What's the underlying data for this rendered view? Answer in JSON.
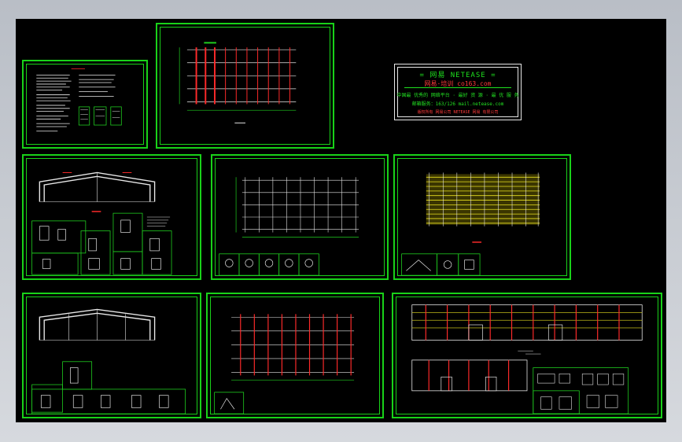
{
  "viewport": {
    "background": "#000000",
    "frame_color": "#19d219"
  },
  "title_block": {
    "title": "= 网易 NETEASE =",
    "line2": "网易·培训  co163.com",
    "line3": "中国最 优秀的 网络平台 · 最好 资 源 · 最 优 服 务",
    "line4": "邮箱服务：163/126 mail.netease.com",
    "line5": "版权所有 网易公司 NETEASE 网易 有限公司"
  },
  "colors": {
    "grid_red": "#ff2a2a",
    "grid_green": "#20d020",
    "text_white": "#e8e8e8",
    "member_yellow": "#e8e020"
  },
  "sheets": [
    {
      "name": "design-notes"
    },
    {
      "name": "column-layout-plan"
    },
    {
      "name": "portal-frame-a"
    },
    {
      "name": "foundation-plan"
    },
    {
      "name": "roof-purlin-plan"
    },
    {
      "name": "portal-frame-b"
    },
    {
      "name": "roof-support-plan"
    },
    {
      "name": "elevations"
    }
  ]
}
